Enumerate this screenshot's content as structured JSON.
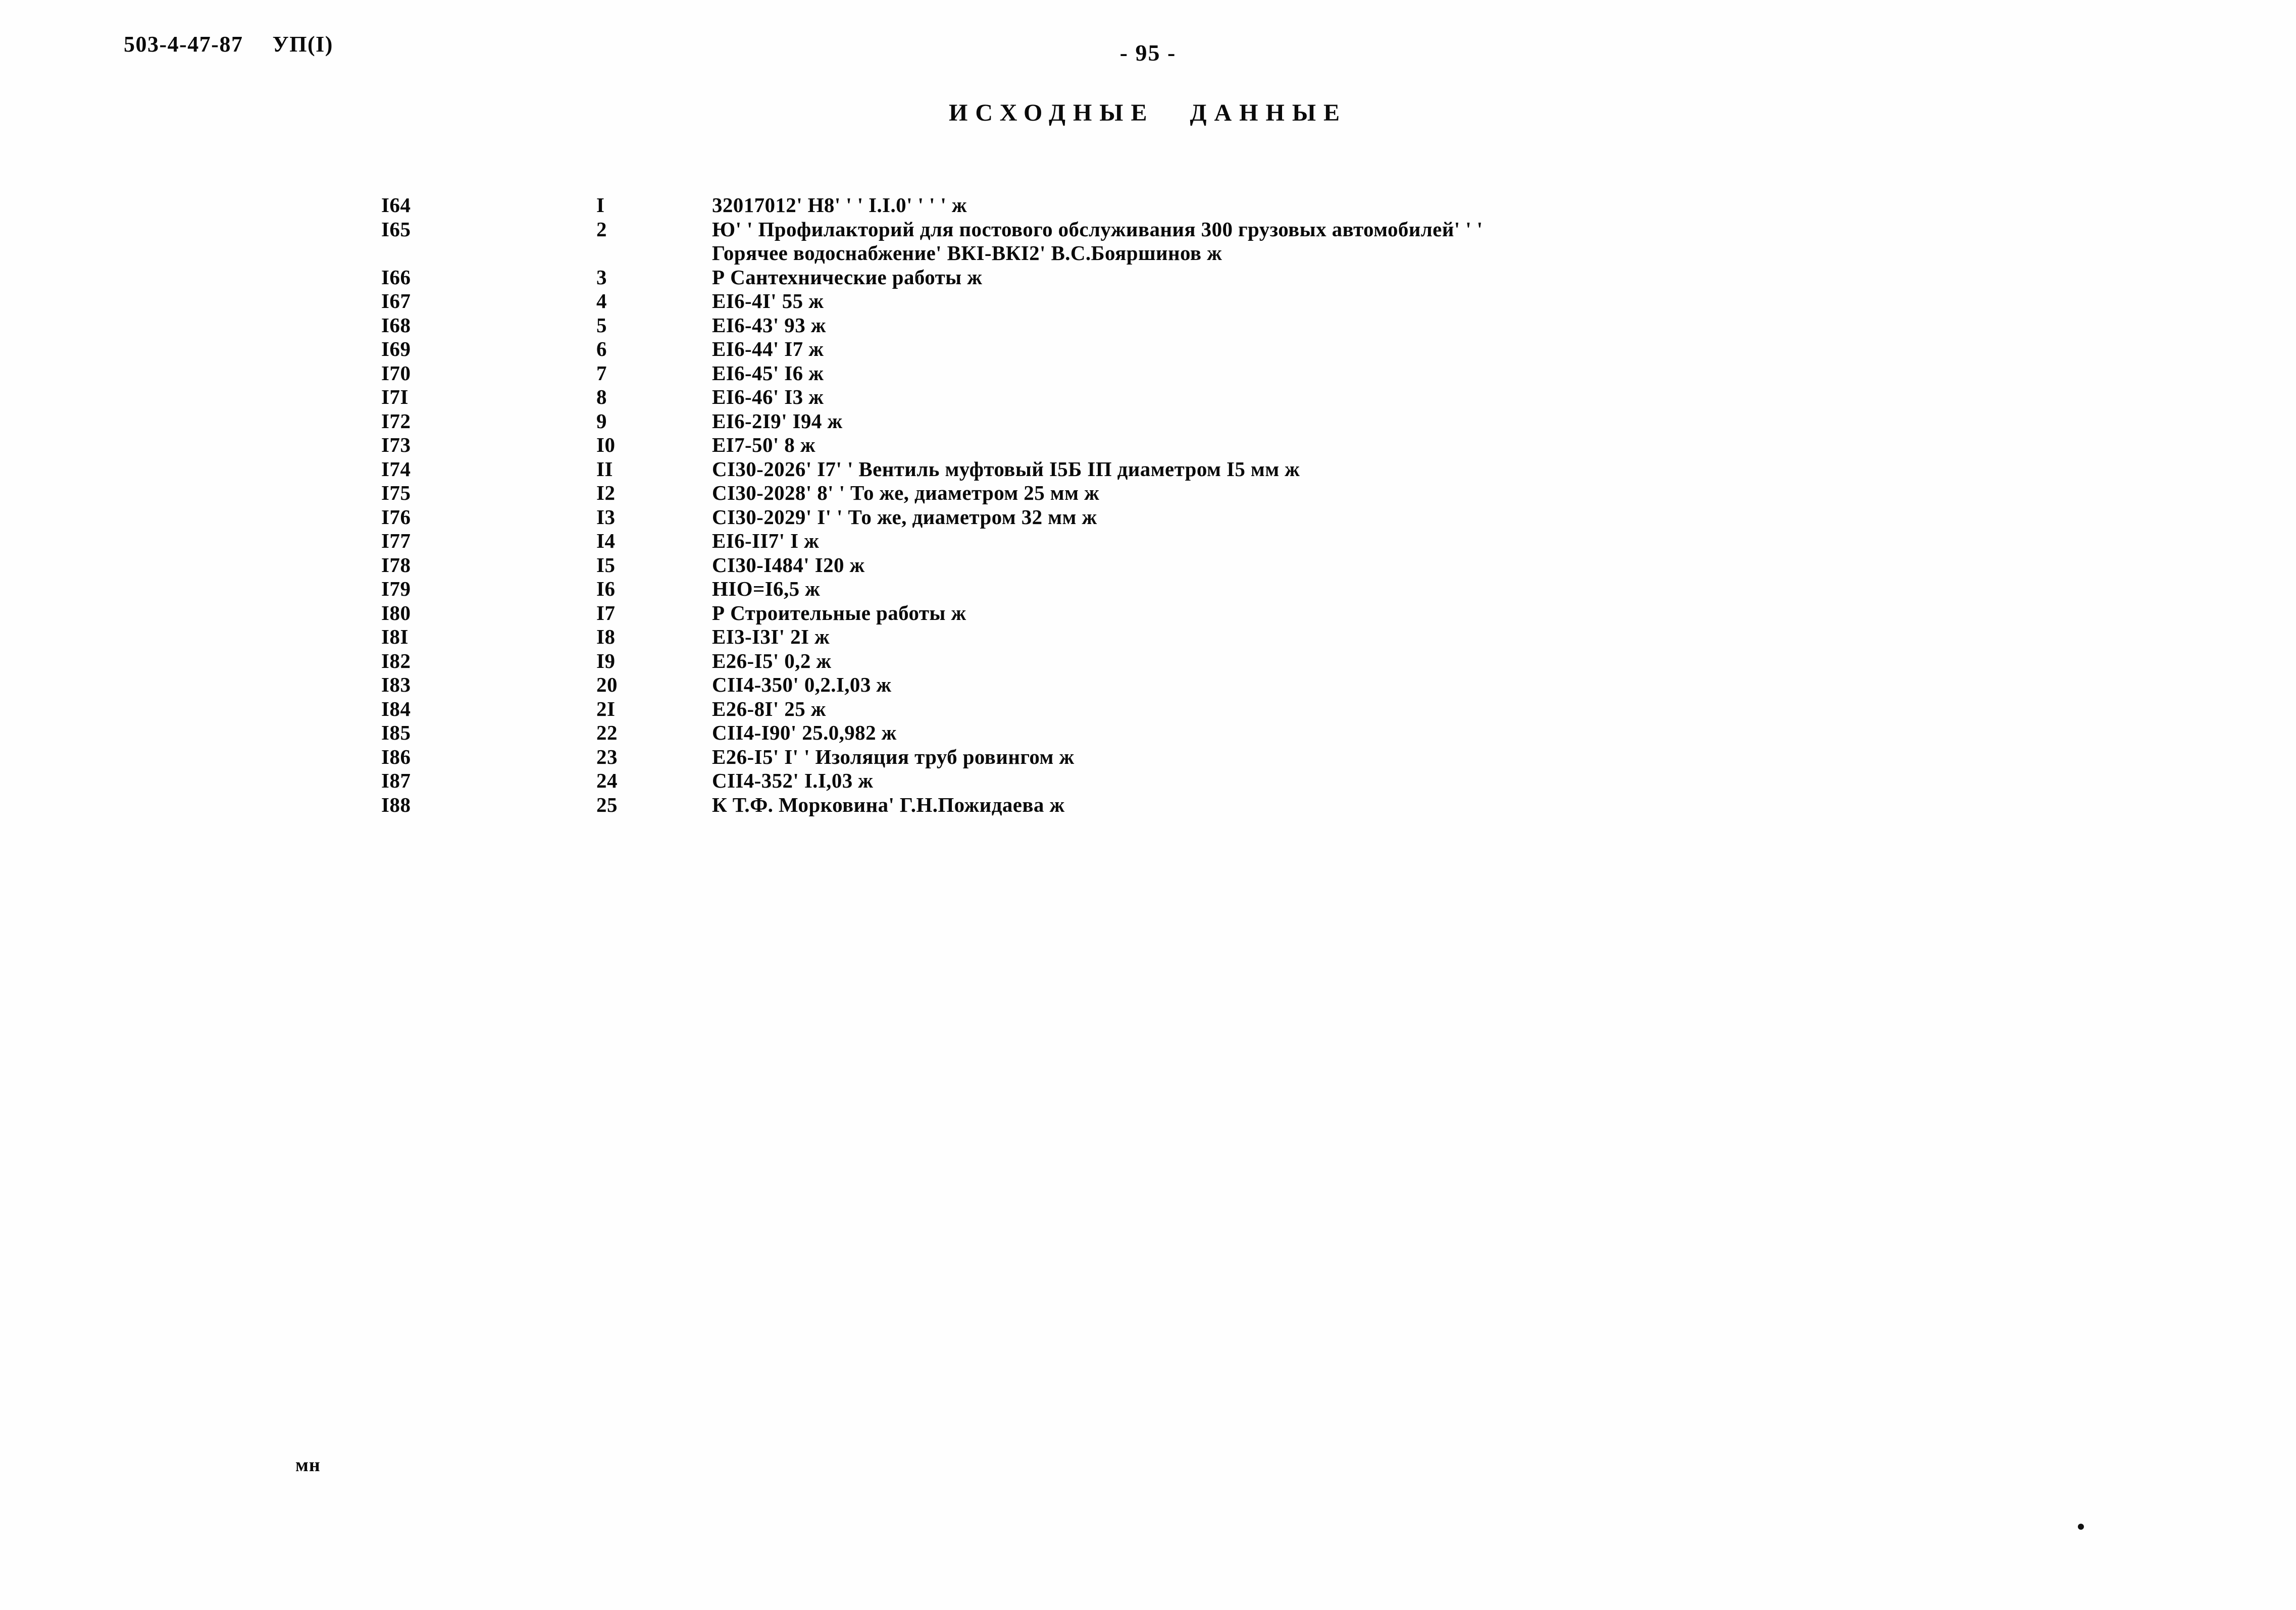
{
  "header": {
    "document_code": "503-4-47-87",
    "section_code": "УП(I)",
    "page_number": "- 95 -",
    "title_part1": "ИСХОДНЫЕ",
    "title_part2": "ДАННЫЕ"
  },
  "listing": {
    "rows": [
      {
        "line": "I64",
        "seq": "I",
        "text": "32017012' H8' ' ' I.I.0' ' ' ' ж",
        "cont": ""
      },
      {
        "line": "I65",
        "seq": "2",
        "text": "Ю' ' Профилакторий для постового обслуживания 300 грузовых автомобилей' ' '",
        "cont": "Горячее водоснабжение' ВКI-ВКI2' В.С.Бояршинов ж"
      },
      {
        "line": "I66",
        "seq": "3",
        "text": "Р Сантехнические работы ж",
        "cont": ""
      },
      {
        "line": "I67",
        "seq": "4",
        "text": "ЕI6-4I' 55 ж",
        "cont": ""
      },
      {
        "line": "I68",
        "seq": "5",
        "text": "ЕI6-43' 93 ж",
        "cont": ""
      },
      {
        "line": "I69",
        "seq": "6",
        "text": "ЕI6-44' I7 ж",
        "cont": ""
      },
      {
        "line": "I70",
        "seq": "7",
        "text": "ЕI6-45' I6 ж",
        "cont": ""
      },
      {
        "line": "I7I",
        "seq": "8",
        "text": "ЕI6-46' I3 ж",
        "cont": ""
      },
      {
        "line": "I72",
        "seq": "9",
        "text": "ЕI6-2I9' I94 ж",
        "cont": ""
      },
      {
        "line": "I73",
        "seq": "I0",
        "text": "ЕI7-50' 8 ж",
        "cont": ""
      },
      {
        "line": "I74",
        "seq": "II",
        "text": "СI30-2026' I7' ' Вентиль муфтовый I5Б IП диаметром I5 мм ж",
        "cont": ""
      },
      {
        "line": "I75",
        "seq": "I2",
        "text": "СI30-2028' 8' ' То же, диаметром 25 мм ж",
        "cont": ""
      },
      {
        "line": "I76",
        "seq": "I3",
        "text": "СI30-2029' I' ' То же, диаметром 32 мм ж",
        "cont": ""
      },
      {
        "line": "I77",
        "seq": "I4",
        "text": "ЕI6-II7' I ж",
        "cont": ""
      },
      {
        "line": "I78",
        "seq": "I5",
        "text": "СI30-I484' I20 ж",
        "cont": ""
      },
      {
        "line": "I79",
        "seq": "I6",
        "text": "НIO=I6,5 ж",
        "cont": ""
      },
      {
        "line": "I80",
        "seq": "I7",
        "text": "Р Строительные работы ж",
        "cont": ""
      },
      {
        "line": "I8I",
        "seq": "I8",
        "text": "ЕI3-I3I' 2I ж",
        "cont": ""
      },
      {
        "line": "I82",
        "seq": "I9",
        "text": "Е26-I5' 0,2 ж",
        "cont": ""
      },
      {
        "line": "I83",
        "seq": "20",
        "text": "СII4-350' 0,2.I,03 ж",
        "cont": ""
      },
      {
        "line": "I84",
        "seq": "2I",
        "text": "Е26-8I' 25 ж",
        "cont": ""
      },
      {
        "line": "I85",
        "seq": "22",
        "text": "СII4-I90' 25.0,982 ж",
        "cont": ""
      },
      {
        "line": "I86",
        "seq": "23",
        "text": "Е26-I5' I' ' Изоляция труб ровингом ж",
        "cont": ""
      },
      {
        "line": "I87",
        "seq": "24",
        "text": "СII4-352' I.I,03 ж",
        "cont": ""
      },
      {
        "line": "I88",
        "seq": "25",
        "text": "К Т.Ф. Морковина' Г.Н.Пожидаева ж",
        "cont": ""
      }
    ]
  },
  "footer": {
    "initials": "мн"
  }
}
